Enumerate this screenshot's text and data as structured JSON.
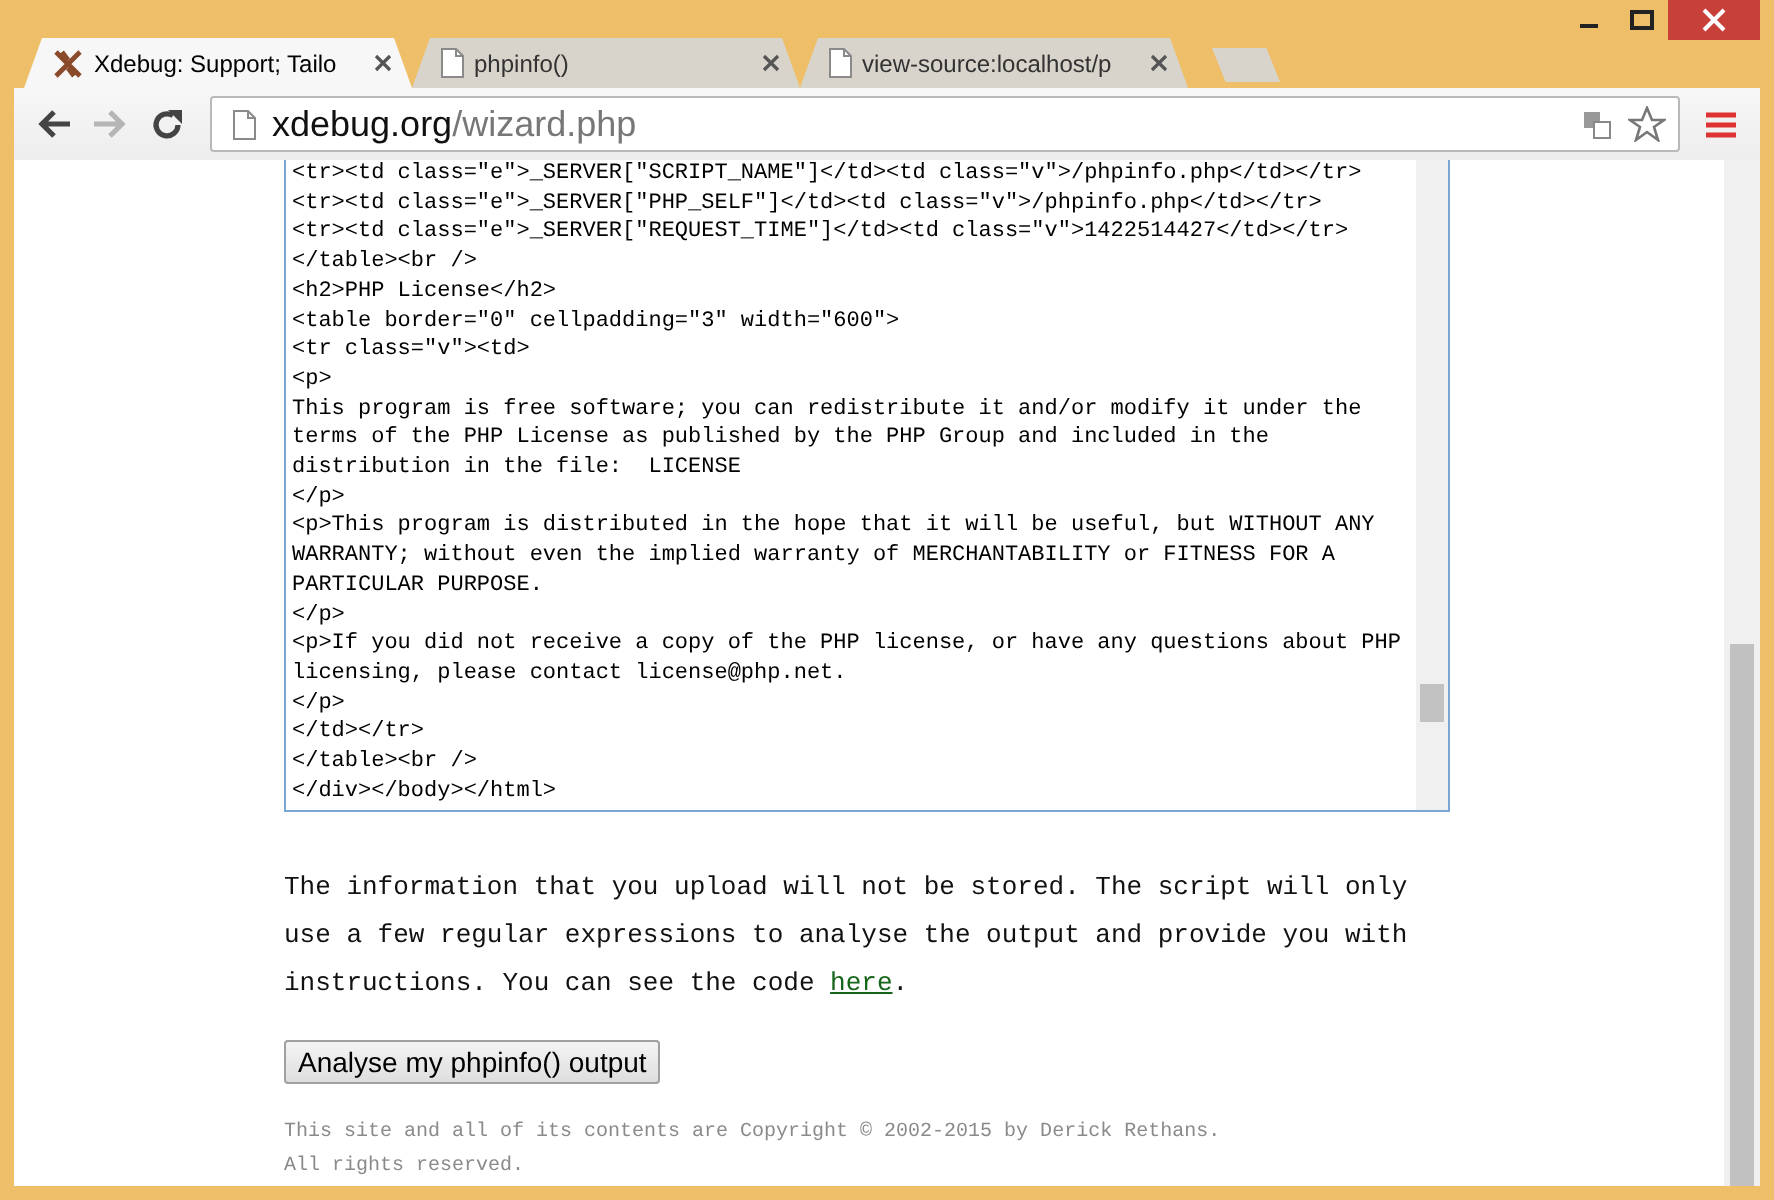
{
  "tabs": [
    {
      "title": "Xdebug: Support; Tailo",
      "kind": "xdebug",
      "selected": true
    },
    {
      "title": "phpinfo()",
      "kind": "page",
      "selected": false
    },
    {
      "title": "view-source:localhost/p",
      "kind": "page",
      "selected": false
    }
  ],
  "address_bar": {
    "host": "xdebug.org",
    "path": "/wizard.php"
  },
  "source_field": {
    "lines": [
      "<tr><td class=\"e\">_SERVER[\"SCRIPT_NAME\"]</td><td class=\"v\">/phpinfo.php</td></tr>",
      "<tr><td class=\"e\">_SERVER[\"PHP_SELF\"]</td><td class=\"v\">/phpinfo.php</td></tr>",
      "<tr><td class=\"e\">_SERVER[\"REQUEST_TIME\"]</td><td class=\"v\">1422514427</td></tr>",
      "</table><br />",
      "<h2>PHP License</h2>",
      "<table border=\"0\" cellpadding=\"3\" width=\"600\">",
      "<tr class=\"v\"><td>",
      "<p>",
      "This program is free software; you can redistribute it and/or modify it under the",
      "terms of the PHP License as published by the PHP Group and included in the",
      "distribution in the file:  LICENSE",
      "</p>",
      "<p>This program is distributed in the hope that it will be useful, but WITHOUT ANY",
      "WARRANTY; without even the implied warranty of MERCHANTABILITY or FITNESS FOR A",
      "PARTICULAR PURPOSE.",
      "</p>",
      "<p>If you did not receive a copy of the PHP license, or have any questions about PHP",
      "licensing, please contact license@php.net.",
      "</p>",
      "</td></tr>",
      "</table><br />",
      "</div></body></html>"
    ]
  },
  "intro": {
    "text": "The information that you upload will not be stored. The script will only use a few regular expressions to analyse the output and provide you with instructions. You can see the code ",
    "link": "here",
    "after": "."
  },
  "submit_button": "Analyse my phpinfo() output",
  "footer": [
    "This site and all of its contents are Copyright © 2002-2015 by Derick Rethans.",
    "All rights reserved."
  ]
}
